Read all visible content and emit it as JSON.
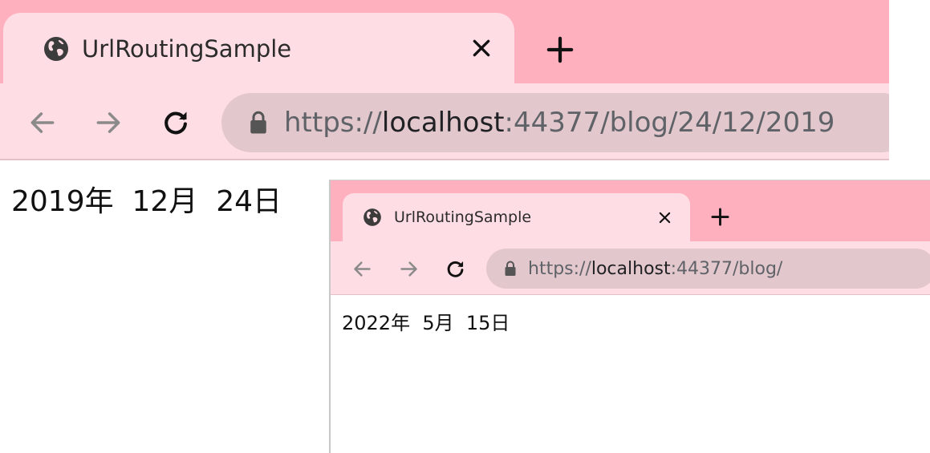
{
  "window1": {
    "tab": {
      "title": "UrlRoutingSample",
      "icon": "globe-icon"
    },
    "toolbar": {
      "back_icon": "back-arrow-icon",
      "forward_icon": "forward-arrow-icon",
      "reload_icon": "reload-icon"
    },
    "address": {
      "scheme": "https://",
      "host": "localhost",
      "rest": ":44377/blog/24/12/2019"
    },
    "content": {
      "date_text": "2019年  12月  24日"
    }
  },
  "window2": {
    "tab": {
      "title": "UrlRoutingSample",
      "icon": "globe-icon"
    },
    "toolbar": {
      "back_icon": "back-arrow-icon",
      "forward_icon": "forward-arrow-icon",
      "reload_icon": "reload-icon"
    },
    "address": {
      "scheme": "https://",
      "host": "localhost",
      "rest": ":44377/blog/"
    },
    "content": {
      "date_text": "2022年  5月  15日"
    }
  },
  "colors": {
    "tabstrip": "#ffb0be",
    "active_tab": "#ffdde4",
    "omnibox": "#e2c7cc"
  }
}
